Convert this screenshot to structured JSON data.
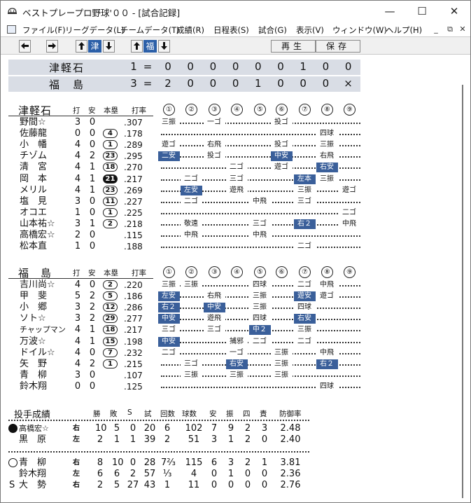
{
  "window": {
    "title": "ベストプレープロ野球'００ - [試合記録]"
  },
  "menu": {
    "items": [
      "ファイル(F)",
      "リーグデータ(L)",
      "チームデータ(T)",
      "成績(R)",
      "日程表(S)",
      "試合(G)",
      "表示(V)",
      "ウィンドウ(W)",
      "ヘルプ(H)"
    ]
  },
  "toolbar": {
    "away_chip": "津",
    "home_chip": "福",
    "play_label": "再生",
    "save_label": "保存"
  },
  "scoreboard": {
    "equals": "=",
    "away": {
      "name": "津軽石",
      "total": "1",
      "innings": [
        "0",
        "0",
        "0",
        "0",
        "0",
        "0",
        "1",
        "0",
        "0"
      ]
    },
    "home": {
      "name": "福　島",
      "total": "3",
      "innings": [
        "2",
        "0",
        "0",
        "0",
        "1",
        "0",
        "0",
        "0",
        "×"
      ]
    }
  },
  "batting_headers": {
    "ab": "打",
    "h": "安",
    "hr": "本塁",
    "avg": "打率",
    "innings": [
      "①",
      "②",
      "③",
      "④",
      "⑤",
      "⑥",
      "⑦",
      "⑧",
      "⑨"
    ]
  },
  "away_batting": {
    "team": "津軽石",
    "rows": [
      {
        "name": "野間☆",
        "ab": "3",
        "h": "0",
        "hr": "",
        "avg": ".307",
        "res": [
          {
            "i": 1,
            "t": "三振"
          },
          {
            "i": 3,
            "t": "一ゴ"
          },
          {
            "i": 6,
            "t": "投ゴ"
          }
        ]
      },
      {
        "name": "佐藤龍",
        "ab": "0",
        "h": "0",
        "hr": "4",
        "avg": ".178",
        "res": [
          {
            "i": 8,
            "t": "四球"
          }
        ]
      },
      {
        "name": "小　幡",
        "ab": "4",
        "h": "0",
        "hr": "1",
        "avg": ".289",
        "res": [
          {
            "i": 1,
            "t": "遊ゴ"
          },
          {
            "i": 3,
            "t": "右飛"
          },
          {
            "i": 6,
            "t": "投ゴ"
          },
          {
            "i": 8,
            "t": "三振"
          }
        ]
      },
      {
        "name": "チゾム",
        "ab": "4",
        "h": "2",
        "hr": "23",
        "avg": ".295",
        "res": [
          {
            "i": 1,
            "t": "二安",
            "hl": true
          },
          {
            "i": 3,
            "t": "投ゴ"
          },
          {
            "i": 6,
            "t": "中安",
            "hl": true
          },
          {
            "i": 8,
            "t": "右飛"
          }
        ]
      },
      {
        "name": "清　宮",
        "ab": "4",
        "h": "1",
        "hr": "18",
        "avg": ".270",
        "res": [
          {
            "i": 4,
            "t": "二ゴ"
          },
          {
            "i": 6,
            "t": "遊ゴ"
          },
          {
            "i": 8,
            "t": "右安",
            "hl": true
          }
        ]
      },
      {
        "name": "岡　本",
        "ab": "4",
        "h": "1",
        "hr": "21",
        "hrFilled": true,
        "avg": ".217",
        "res": [
          {
            "i": 2,
            "t": "二ゴ"
          },
          {
            "i": 4,
            "t": "三ゴ"
          },
          {
            "i": 7,
            "t": "左本",
            "hl": true
          },
          {
            "i": 8,
            "t": "三振"
          }
        ]
      },
      {
        "name": "メリル",
        "ab": "4",
        "h": "1",
        "hr": "23",
        "avg": ".269",
        "res": [
          {
            "i": 2,
            "t": "左安",
            "hl": true
          },
          {
            "i": 4,
            "t": "遊飛"
          },
          {
            "i": 7,
            "t": "三振"
          },
          {
            "i": 9,
            "t": "遊ゴ"
          }
        ]
      },
      {
        "name": "塩　見",
        "ab": "3",
        "h": "0",
        "hr": "11",
        "avg": ".227",
        "res": [
          {
            "i": 2,
            "t": "二ゴ"
          },
          {
            "i": 5,
            "t": "中飛"
          },
          {
            "i": 7,
            "t": "三ゴ"
          }
        ]
      },
      {
        "name": "オコエ",
        "ab": "1",
        "h": "0",
        "hr": "1",
        "avg": ".225",
        "res": [
          {
            "i": 9,
            "t": "二ゴ"
          }
        ]
      },
      {
        "name": "山本祐☆",
        "ab": "3",
        "h": "1",
        "hr": "2",
        "avg": ".218",
        "res": [
          {
            "i": 2,
            "t": "敬遠"
          },
          {
            "i": 5,
            "t": "三ゴ"
          },
          {
            "i": 7,
            "t": "右２",
            "hl": true
          },
          {
            "i": 9,
            "t": "中飛"
          }
        ]
      },
      {
        "name": "高橋宏☆",
        "ab": "2",
        "h": "0",
        "hr": "",
        "avg": ".115",
        "res": [
          {
            "i": 2,
            "t": "中飛"
          },
          {
            "i": 5,
            "t": "中飛"
          }
        ]
      },
      {
        "name": "松本直",
        "ab": "1",
        "h": "0",
        "hr": "",
        "avg": ".188",
        "res": [
          {
            "i": 7,
            "t": "二ゴ"
          }
        ]
      }
    ]
  },
  "home_batting": {
    "team": "福　島",
    "rows": [
      {
        "name": "吉川尚☆",
        "ab": "4",
        "h": "0",
        "hr": "2",
        "avg": ".220",
        "res": [
          {
            "i": 1,
            "t": "三振"
          },
          {
            "i": 2,
            "t": "三振"
          },
          {
            "i": 5,
            "t": "四球"
          },
          {
            "i": 7,
            "t": "二ゴ"
          },
          {
            "i": 8,
            "t": "中飛"
          }
        ]
      },
      {
        "name": "甲　斐",
        "ab": "5",
        "h": "2",
        "hr": "5",
        "avg": ".186",
        "res": [
          {
            "i": 1,
            "t": "左安",
            "hl": true
          },
          {
            "i": 3,
            "t": "右飛"
          },
          {
            "i": 5,
            "t": "三振"
          },
          {
            "i": 7,
            "t": "遊安",
            "hl": true
          },
          {
            "i": 8,
            "t": "遊ゴ"
          }
        ]
      },
      {
        "name": "小　郷",
        "ab": "3",
        "h": "2",
        "hr": "12",
        "avg": ".286",
        "res": [
          {
            "i": 1,
            "t": "右２",
            "hl": true
          },
          {
            "i": 3,
            "t": "中安",
            "hl": true
          },
          {
            "i": 5,
            "t": "三振"
          },
          {
            "i": 7,
            "t": "四球"
          }
        ]
      },
      {
        "name": "ソト☆",
        "ab": "3",
        "h": "2",
        "hr": "29",
        "avg": ".277",
        "res": [
          {
            "i": 1,
            "t": "中安",
            "hl": true
          },
          {
            "i": 3,
            "t": "遊飛"
          },
          {
            "i": 5,
            "t": "四球"
          },
          {
            "i": 7,
            "t": "右安",
            "hl": true
          }
        ]
      },
      {
        "name": "チャップマン",
        "ab": "4",
        "h": "1",
        "hr": "18",
        "avg": ".217",
        "res": [
          {
            "i": 1,
            "t": "三ゴ"
          },
          {
            "i": 3,
            "t": "三ゴ"
          },
          {
            "i": 5,
            "t": "中２",
            "hl": true
          },
          {
            "i": 7,
            "t": "三振"
          }
        ]
      },
      {
        "name": "万波☆",
        "ab": "4",
        "h": "1",
        "hr": "15",
        "avg": ".198",
        "res": [
          {
            "i": 1,
            "t": "中安",
            "hl": true
          },
          {
            "i": 4,
            "t": "捕邪"
          },
          {
            "i": 5,
            "t": "二ゴ"
          },
          {
            "i": 7,
            "t": "二ゴ"
          }
        ]
      },
      {
        "name": "ドイル☆",
        "ab": "4",
        "h": "0",
        "hr": "7",
        "avg": ".232",
        "res": [
          {
            "i": 1,
            "t": "二ゴ"
          },
          {
            "i": 4,
            "t": "一ゴ"
          },
          {
            "i": 6,
            "t": "三振"
          },
          {
            "i": 8,
            "t": "中飛"
          }
        ]
      },
      {
        "name": "矢　野",
        "ab": "4",
        "h": "2",
        "hr": "1",
        "avg": ".215",
        "res": [
          {
            "i": 2,
            "t": "三ゴ"
          },
          {
            "i": 4,
            "t": "右安",
            "hl": true
          },
          {
            "i": 6,
            "t": "三振"
          },
          {
            "i": 8,
            "t": "右２",
            "hl": true
          }
        ]
      },
      {
        "name": "青　柳",
        "ab": "3",
        "h": "0",
        "hr": "",
        "avg": ".107",
        "res": [
          {
            "i": 2,
            "t": "三振"
          },
          {
            "i": 4,
            "t": "三振"
          },
          {
            "i": 6,
            "t": "三振"
          }
        ]
      },
      {
        "name": "鈴木翔",
        "ab": "0",
        "h": "0",
        "hr": "",
        "avg": ".125",
        "res": [
          {
            "i": 8,
            "t": "四球"
          }
        ]
      }
    ]
  },
  "pitching": {
    "title": "投手成績",
    "headers": [
      "勝",
      "敗",
      "S",
      "試",
      "回数",
      "球数",
      "安",
      "振",
      "四",
      "責",
      "防御率"
    ],
    "away": [
      {
        "mark": "win",
        "name": "高橋宏☆",
        "hand": "右",
        "w": "10",
        "l": "5",
        "s": "0",
        "g": "20",
        "ip": "6",
        "np": "102",
        "h": "7",
        "so": "9",
        "bb": "2",
        "er": "3",
        "era": "2.48"
      },
      {
        "mark": "",
        "name": "黒　原",
        "hand": "左",
        "w": "2",
        "l": "1",
        "s": "1",
        "g": "39",
        "ip": "2",
        "np": "51",
        "h": "3",
        "so": "1",
        "bb": "2",
        "er": "0",
        "era": "2.40"
      }
    ],
    "home": [
      {
        "mark": "loss",
        "name": "青　柳",
        "hand": "右",
        "w": "8",
        "l": "10",
        "s": "0",
        "g": "28",
        "ip": "7⅔",
        "np": "115",
        "h": "6",
        "so": "3",
        "bb": "2",
        "er": "1",
        "era": "3.81"
      },
      {
        "mark": "",
        "name": "鈴木翔",
        "hand": "左",
        "w": "6",
        "l": "6",
        "s": "2",
        "g": "57",
        "ip": "⅓",
        "np": "4",
        "h": "0",
        "so": "1",
        "bb": "0",
        "er": "0",
        "era": "2.36"
      },
      {
        "mark": "save",
        "save_label": "S",
        "name": "大　勢",
        "hand": "右",
        "w": "2",
        "l": "5",
        "s": "27",
        "g": "43",
        "ip": "1",
        "np": "11",
        "h": "0",
        "so": "0",
        "bb": "0",
        "er": "0",
        "era": "2.76"
      }
    ]
  }
}
